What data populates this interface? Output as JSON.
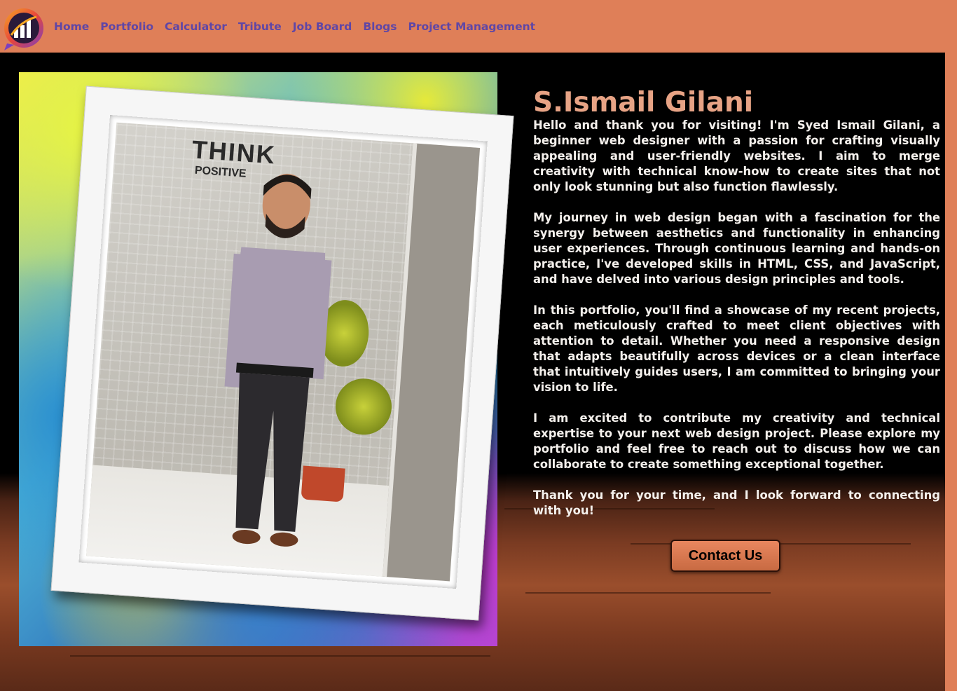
{
  "nav": {
    "logo_name": "logo-icon",
    "links": [
      {
        "label": "Home"
      },
      {
        "label": "Portfolio"
      },
      {
        "label": "Calculator"
      },
      {
        "label": "Tribute"
      },
      {
        "label": "Job Board"
      },
      {
        "label": "Blogs"
      },
      {
        "label": "Project Management"
      }
    ]
  },
  "profile": {
    "name": "S.Ismail Gilani",
    "photo_sign_big": "THINK",
    "photo_sign_small": "POSITIVE",
    "paragraphs": [
      "Hello and thank you for visiting! I'm Syed Ismail Gilani, a beginner web designer with a passion for crafting visually appealing and user-friendly websites. I aim to merge creativity with technical know-how to create sites that not only look stunning but also function flawlessly.",
      "My journey in web design began with a fascination for the synergy between aesthetics and functionality in enhancing user experiences. Through continuous learning and hands-on practice, I've developed skills in HTML, CSS, and JavaScript, and have delved into various design principles and tools.",
      "In this portfolio, you'll find a showcase of my recent projects, each meticulously crafted to meet client objectives with attention to detail. Whether you need a responsive design that adapts beautifully across devices or a clean interface that intuitively guides users, I am committed to bringing your vision to life.",
      "I am excited to contribute my creativity and technical expertise to your next web design project. Please explore my portfolio and feel free to reach out to discuss how we can collaborate to create something exceptional together.",
      "Thank you for your time, and I look forward to connecting with you!"
    ],
    "contact_label": "Contact Us"
  },
  "colors": {
    "nav_bg": "#df7f58",
    "nav_link": "#5f46a6",
    "title": "#e7a385",
    "text": "#f4f0ec"
  }
}
